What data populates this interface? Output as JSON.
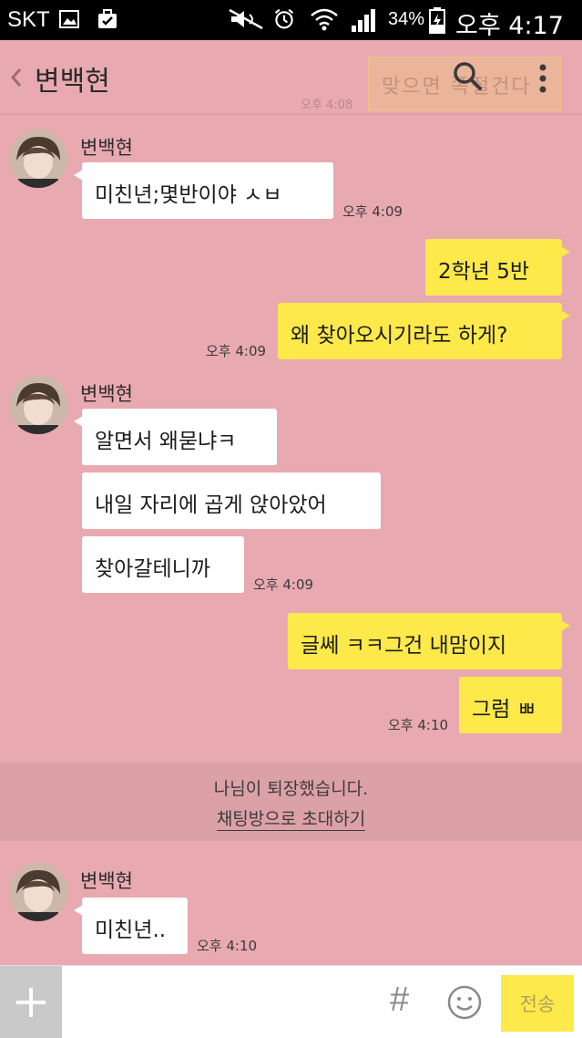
{
  "status_bar": {
    "carrier": "SKT",
    "battery_percent": "34%",
    "time": "오후 4:17"
  },
  "header": {
    "title": "변백현",
    "ghost_preview": "맞으면 쪽절건다",
    "ghost_time": "오후 4:08"
  },
  "messages": [
    {
      "sender": "변백현",
      "text": "미친년;몇반이야 ㅅㅂ",
      "time": "오후 4:09"
    },
    {
      "text": "2학년 5반"
    },
    {
      "text": "왜 찾아오시기라도 하게?",
      "time": "오후 4:09"
    },
    {
      "sender": "변백현",
      "text": "알면서 왜묻냐ㅋ"
    },
    {
      "text": "내일 자리에 곱게 앉아았어"
    },
    {
      "text": "찾아갈테니까",
      "time": "오후 4:09"
    },
    {
      "text": "글쎄 ㅋㅋ그건 내맘이지"
    },
    {
      "text": "그럼 ㅃ",
      "time": "오후 4:10"
    },
    {
      "sender": "변백현",
      "text": "미친년..",
      "time": "오후 4:10"
    }
  ],
  "notice": {
    "left_text": "나님이 퇴장했습니다.",
    "invite_link": "채팅방으로 초대하기"
  },
  "input_bar": {
    "placeholder": "",
    "hash_label": "#",
    "send_label": "전송"
  },
  "colors": {
    "background": "#e8a9b0",
    "my_bubble": "#fee94a",
    "their_bubble": "#ffffff"
  },
  "icons": [
    "image-icon",
    "briefcase-icon",
    "mute-icon",
    "alarm-icon",
    "wifi-icon",
    "signal-icon",
    "battery-icon",
    "back-chevron-icon",
    "search-icon",
    "more-menu-icon",
    "plus-icon",
    "emoji-icon"
  ]
}
